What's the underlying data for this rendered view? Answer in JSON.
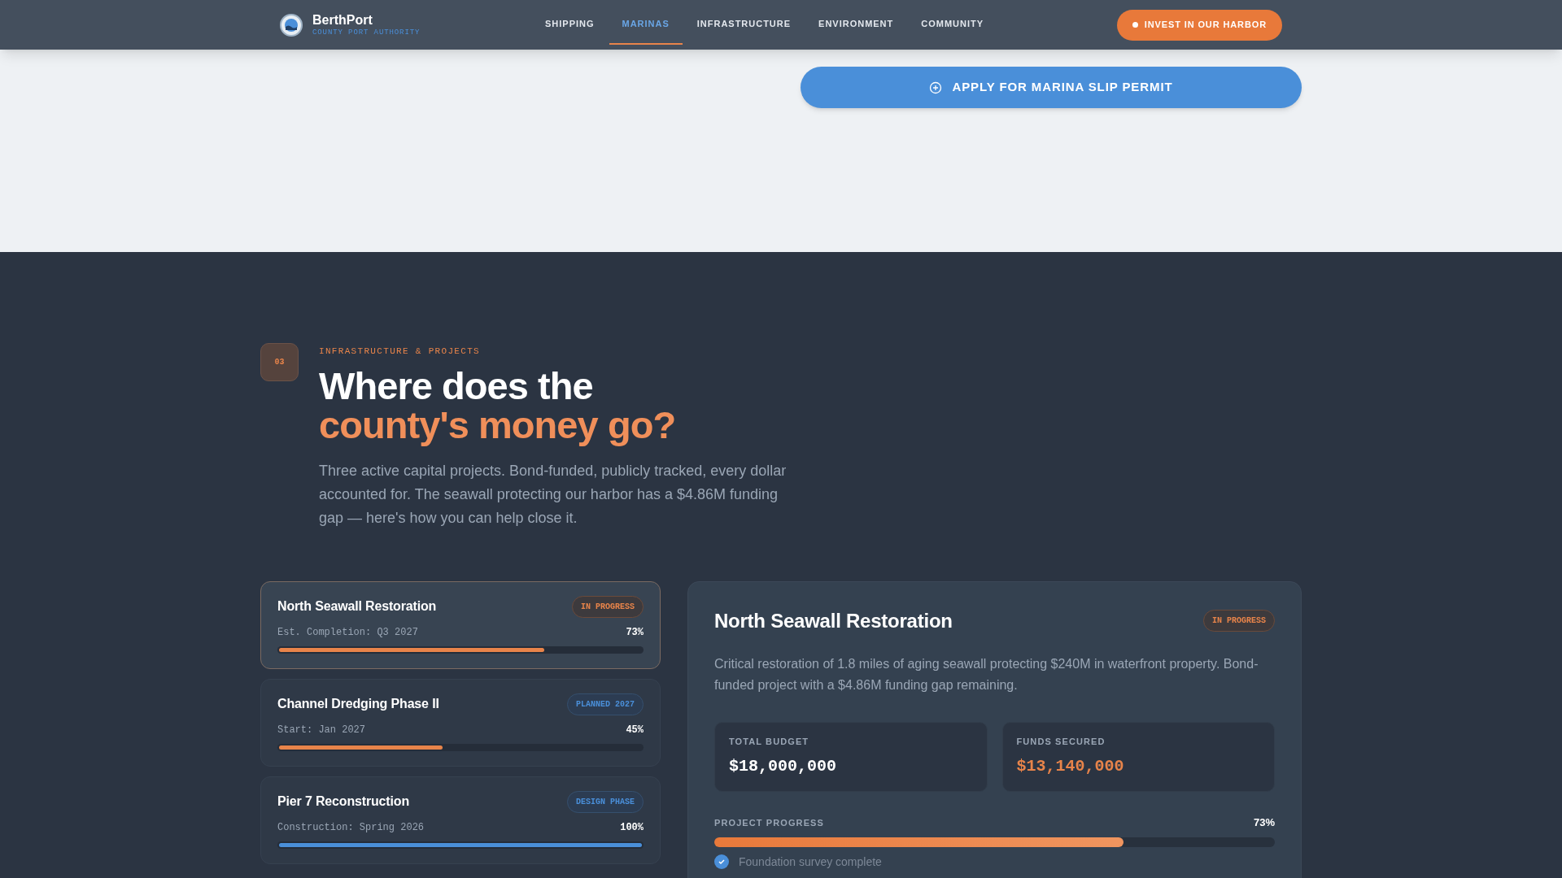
{
  "brand": {
    "name": "BerthPort",
    "tagline": "COUNTY PORT AUTHORITY"
  },
  "nav": [
    {
      "label": "SHIPPING",
      "selected": false
    },
    {
      "label": "MARINAS",
      "selected": true
    },
    {
      "label": "INFRASTRUCTURE",
      "selected": false
    },
    {
      "label": "ENVIRONMENT",
      "selected": false
    },
    {
      "label": "COMMUNITY",
      "selected": false
    }
  ],
  "invest_button": "INVEST IN OUR HARBOR",
  "permit_button": "APPLY FOR MARINA SLIP PERMIT",
  "section": {
    "number": "03",
    "eyebrow": "INFRASTRUCTURE & PROJECTS",
    "title_line_1": "Where does the",
    "title_line_2": "county's money go?",
    "intro": "Three active capital projects. Bond-funded, publicly tracked, every dollar accounted for. The seawall protecting our harbor has a $4.86M funding gap — here's how you can help close it."
  },
  "projects": [
    {
      "name": "North Seawall Restoration",
      "status": "IN PROGRESS",
      "kind": "active",
      "date": "Est. Completion: Q3 2027",
      "level": 0.73,
      "reading": "73%",
      "selected": true
    },
    {
      "name": "Channel Dredging Phase II",
      "status": "PLANNED 2027",
      "kind": "planned",
      "date": "Start: Jan 2027",
      "level": 0.45,
      "reading": "45%",
      "selected": false
    },
    {
      "name": "Pier 7 Reconstruction",
      "status": "DESIGN PHASE",
      "kind": "design",
      "date": "Construction: Spring 2026",
      "level": 1,
      "reading": "100%",
      "selected": false
    }
  ],
  "detail": {
    "title": "North Seawall Restoration",
    "status": "IN PROGRESS",
    "description": "Critical restoration of 1.8 miles of aging seawall protecting $240M in waterfront property. Bond-funded project with a $4.86M funding gap remaining.",
    "stats": [
      {
        "label": "TOTAL BUDGET",
        "value": "$18,000,000",
        "kind": "plain"
      },
      {
        "label": "FUNDS SECURED",
        "value": "$13,140,000",
        "kind": "highlight"
      }
    ],
    "progress": {
      "label": "PROJECT PROGRESS",
      "reading": "73%",
      "level": 0.73
    },
    "milestones": [
      {
        "label": "Foundation survey complete",
        "done": true
      }
    ]
  }
}
